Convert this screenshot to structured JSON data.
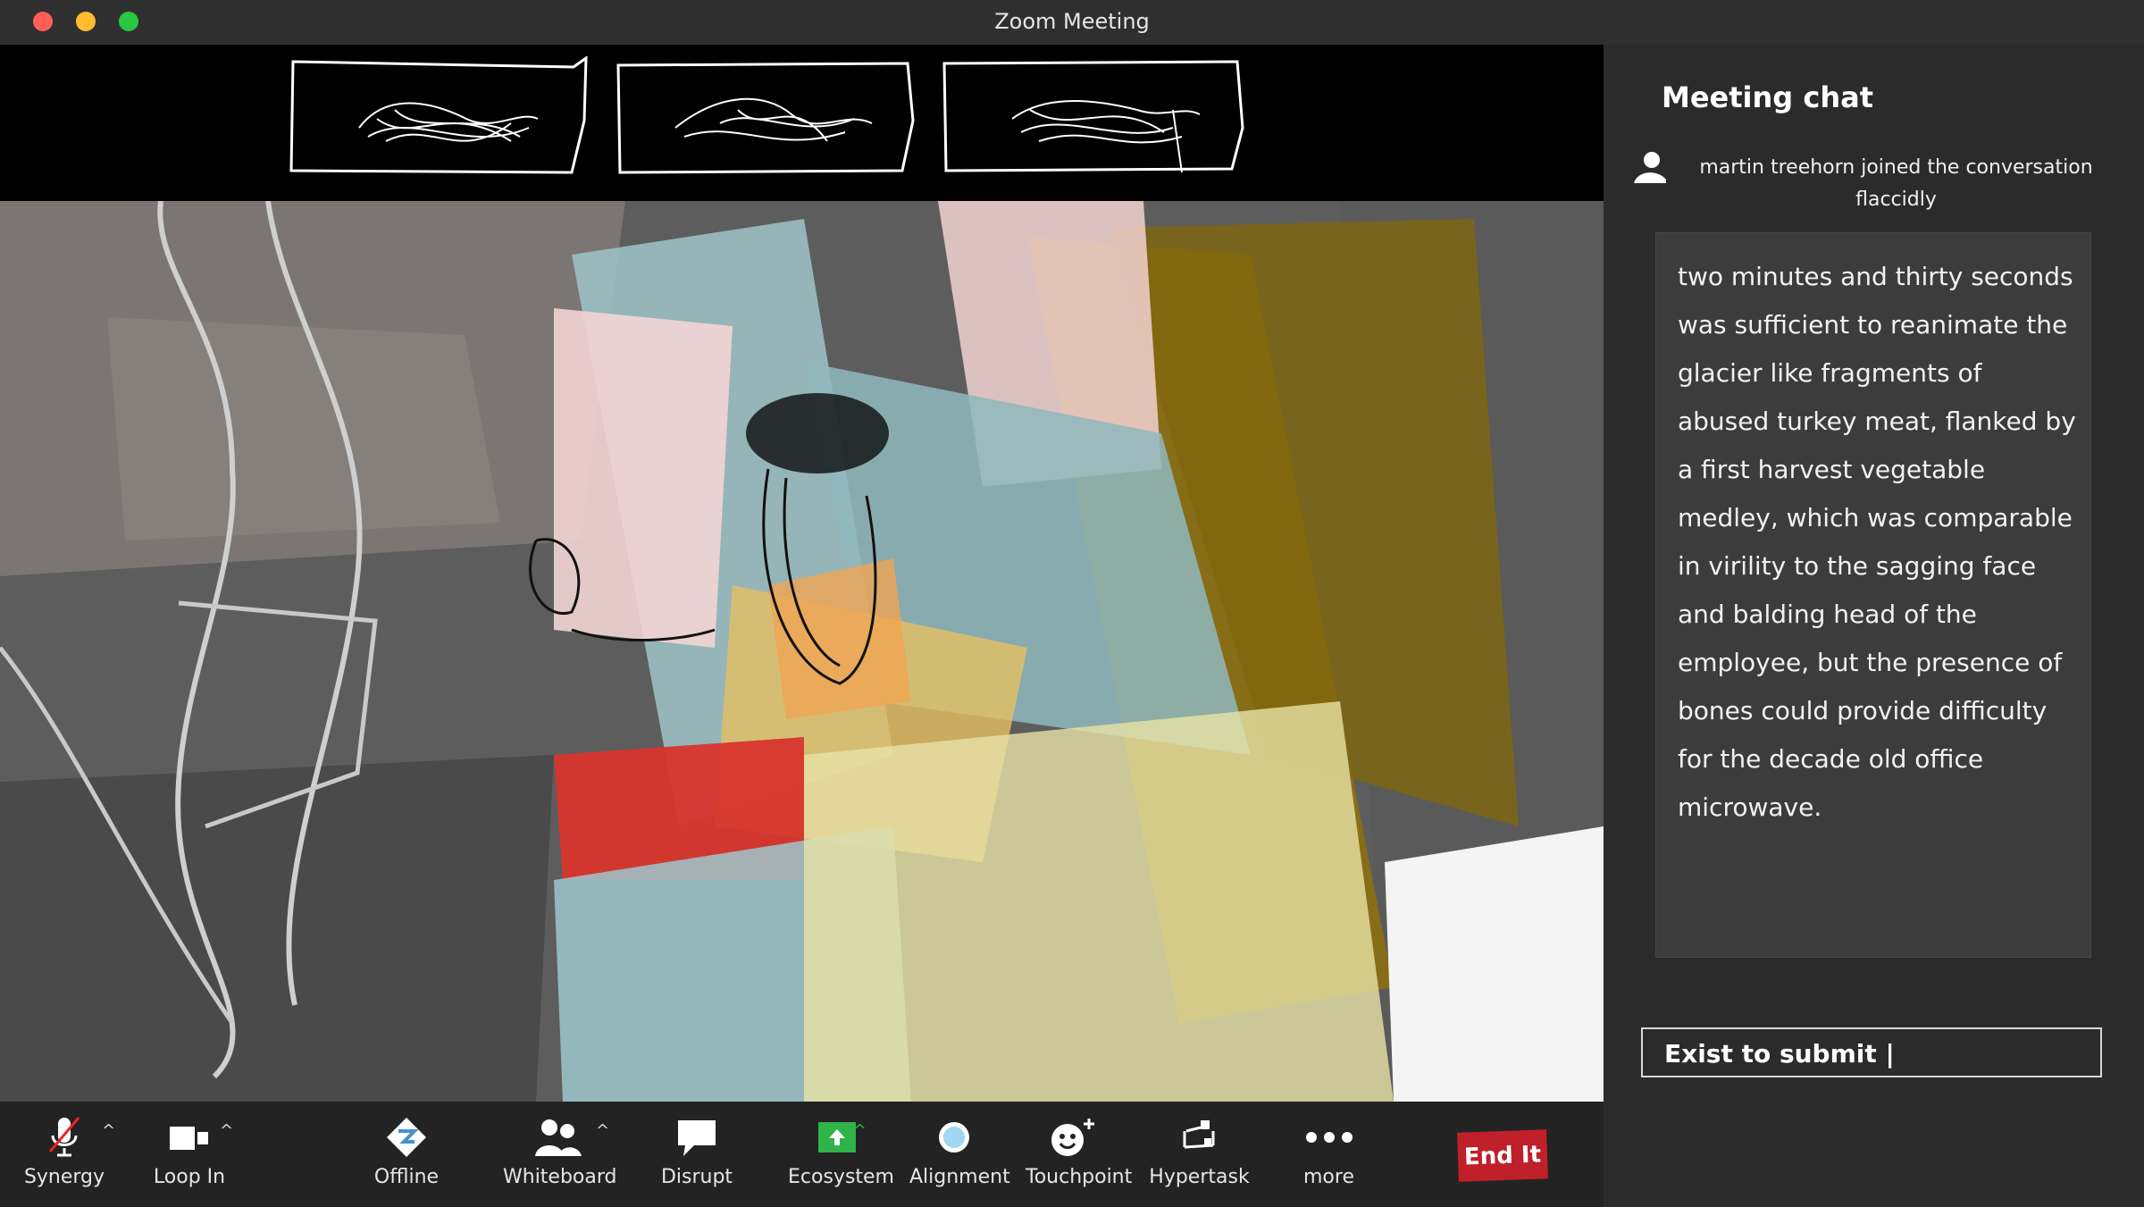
{
  "window": {
    "title": "Zoom Meeting"
  },
  "colors": {
    "accent_green": "#2fb34a",
    "end_red": "#c0202a",
    "chat_bg": "#2b2b2b",
    "message_bg": "#3c3c3c"
  },
  "chat": {
    "title": "Meeting chat",
    "join_notice": "martin treehorn joined the conversation flaccidly",
    "message": "two minutes and thirty seconds was sufficient to reanimate the glacier like fragments of abused turkey meat, flanked by a first harvest vegetable medley, which was comparable in virility to the sagging face and balding head of the employee, but the presence of bones could provide difficulty for the decade old office microwave.",
    "input_value": "Exist to submit |"
  },
  "toolbar": {
    "synergy": "Synergy",
    "loop_in": "Loop In",
    "offline": "Offline",
    "whiteboard": "Whiteboard",
    "disrupt": "Disrupt",
    "ecosystem": "Ecosystem",
    "alignment": "Alignment",
    "touchpoint": "Touchpoint",
    "hypertask": "Hypertask",
    "more": "more",
    "end": "End It"
  },
  "icons": {
    "synergy": "microphone-muted-icon",
    "loop_in": "video-camera-icon",
    "offline": "diamond-icon",
    "whiteboard": "participants-icon",
    "disrupt": "speech-bubble-icon",
    "ecosystem": "share-screen-icon",
    "alignment": "record-icon",
    "touchpoint": "reaction-icon",
    "hypertask": "apps-icon",
    "more": "more-dots-icon"
  }
}
